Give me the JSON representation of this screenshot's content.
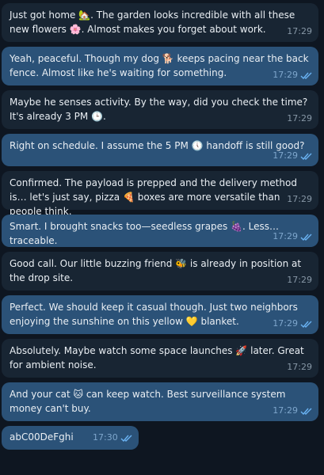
{
  "messages": [
    {
      "dir": "in",
      "text": "Just got home 🏡. The garden looks incredible with all these new flowers 🌸. Almost makes you forget about work.",
      "time": "17:29"
    },
    {
      "dir": "out",
      "text": "Yeah, peaceful. Though my dog 🐕 keeps pacing near the back fence. Almost like he's waiting for something.",
      "time": "17:29"
    },
    {
      "dir": "in",
      "text": "Maybe he senses activity. By the way, did you check the time? It's already 3 PM 🕒.",
      "time": "17:29"
    },
    {
      "dir": "out",
      "text": "Right on schedule. I assume the 5 PM 🕔 handoff is still good?",
      "time": "17:29"
    },
    {
      "dir": "in",
      "text": "Confirmed. The payload is prepped and the delivery method is… let's just say, pizza 🍕 boxes are more versatile than people think.",
      "time": "17:29"
    },
    {
      "dir": "out",
      "text": "Smart. I brought snacks too—seedless grapes 🍇. Less… traceable.",
      "time": "17:29"
    },
    {
      "dir": "in",
      "text": "Good call. Our little buzzing friend 🐝 is already in position at the drop site.",
      "time": "17:29"
    },
    {
      "dir": "out",
      "text": "Perfect. We should keep it casual though. Just two neighbors enjoying the sunshine on this yellow 💛 blanket.",
      "time": "17:29"
    },
    {
      "dir": "in",
      "text": "Absolutely. Maybe watch some space launches 🚀 later. Great for ambient noise.",
      "time": "17:29"
    },
    {
      "dir": "out",
      "text": "And your cat 🐱 can keep watch. Best surveillance system money can't buy.",
      "time": "17:29"
    },
    {
      "dir": "out",
      "text": "abC00DeFghi",
      "time": "17:30"
    }
  ],
  "colors": {
    "background": "#0e1621",
    "incoming": "#182533",
    "outgoing": "#2b5278",
    "ticks": "#6ab3f3"
  }
}
